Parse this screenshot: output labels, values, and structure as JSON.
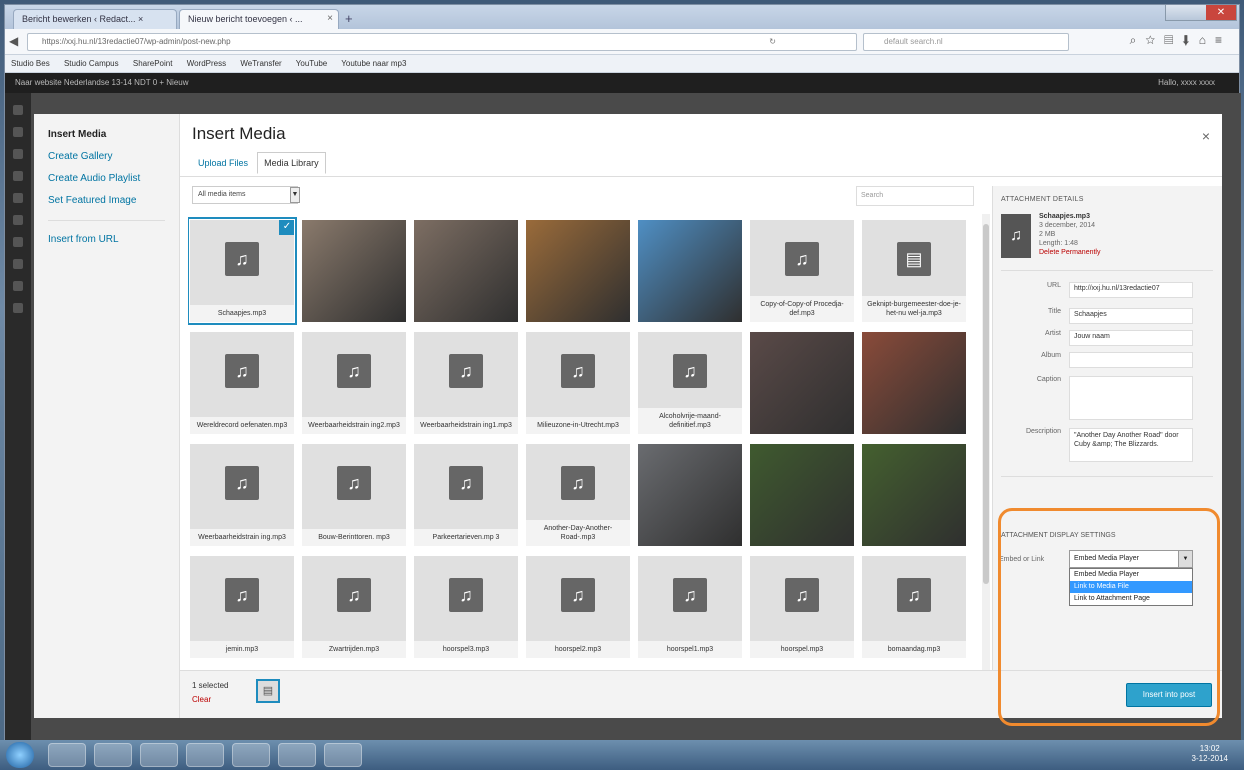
{
  "browser": {
    "tabs": [
      "Bericht bewerken ‹ Redact... ×",
      "Nieuw bericht toevoegen ‹ ..."
    ],
    "url": "https://xxj.hu.nl/13redactie07/wp-admin/post-new.php",
    "search_placeholder": "default search.nl",
    "bookmarks": [
      "Studio Bes",
      "Studio Campus",
      "SharePoint",
      "WordPress",
      "WeTransfer",
      "YouTube",
      "Youtube naar mp3"
    ]
  },
  "wpbar": {
    "left": "Naar website     Nederlandse 13-14 NDT     0     +  Nieuw",
    "right": "Hallo, xxxx xxxx"
  },
  "sidebar": {
    "title": "Insert Media",
    "items": [
      "Create Gallery",
      "Create Audio Playlist",
      "Set Featured Image",
      "Insert from URL"
    ]
  },
  "modal": {
    "title": "Insert Media",
    "close": "×",
    "tabs": [
      "Upload Files",
      "Media Library"
    ],
    "filter": "All media items",
    "search_placeholder": "Search"
  },
  "media": [
    {
      "caption": "Schaapjes.mp3",
      "type": "audio",
      "selected": true
    },
    {
      "caption": "",
      "type": "image",
      "color": "#8a7a6c"
    },
    {
      "caption": "",
      "type": "image",
      "color": "#7d6e63"
    },
    {
      "caption": "",
      "type": "image",
      "color": "#9a6b3a"
    },
    {
      "caption": "",
      "type": "image",
      "color": "#4f8fc4"
    },
    {
      "caption": "Copy-of-Copy-of Procedja-def.mp3",
      "type": "audio"
    },
    {
      "caption": "Geknipt-burgemeester-doe-je-het-nu wel-ja.mp3",
      "type": "doc"
    },
    {
      "caption": "Wereldrecord oefenaten.mp3",
      "type": "audio"
    },
    {
      "caption": "Weerbaarheidstrain ing2.mp3",
      "type": "audio"
    },
    {
      "caption": "Weerbaarheidstrain ing1.mp3",
      "type": "audio"
    },
    {
      "caption": "Milieuzone-in-Utrecht.mp3",
      "type": "audio"
    },
    {
      "caption": "Alcoholvrije-maand-definitief.mp3",
      "type": "audio"
    },
    {
      "caption": "",
      "type": "image",
      "color": "#5a4a48"
    },
    {
      "caption": "",
      "type": "image",
      "color": "#8a4b3a"
    },
    {
      "caption": "Weerbaarheidstrain ing.mp3",
      "type": "audio"
    },
    {
      "caption": "Bouw-Berinttoren. mp3",
      "type": "audio"
    },
    {
      "caption": "Parkeertarieven.mp 3",
      "type": "audio"
    },
    {
      "caption": "Another-Day-Another-Road-.mp3",
      "type": "audio"
    },
    {
      "caption": "",
      "type": "image",
      "color": "#6a6c70"
    },
    {
      "caption": "",
      "type": "image",
      "color": "#3f5a2f"
    },
    {
      "caption": "",
      "type": "image",
      "color": "#44602f"
    },
    {
      "caption": "jemin.mp3",
      "type": "audio"
    },
    {
      "caption": "Zwartrijden.mp3",
      "type": "audio"
    },
    {
      "caption": "hoorspel3.mp3",
      "type": "audio"
    },
    {
      "caption": "hoorspel2.mp3",
      "type": "audio"
    },
    {
      "caption": "hoorspel1.mp3",
      "type": "audio"
    },
    {
      "caption": "hoorspel.mp3",
      "type": "audio"
    },
    {
      "caption": "bomaandag.mp3",
      "type": "audio"
    }
  ],
  "details": {
    "heading": "ATTACHMENT DETAILS",
    "filename": "Schaapjes.mp3",
    "date": "3 december, 2014",
    "size": "2 MB",
    "length": "Length: 1:48",
    "delete": "Delete Permanently",
    "fields": [
      {
        "label": "URL",
        "value": "http://xxj.hu.nl/13redactie07"
      },
      {
        "label": "Title",
        "value": "Schaapjes"
      },
      {
        "label": "Artist",
        "value": "Jouw naam"
      },
      {
        "label": "Album",
        "value": ""
      },
      {
        "label": "Caption",
        "value": ""
      },
      {
        "label": "Description",
        "value": "\"Another Day Another Road\" door Cuby &amp; The Blizzards."
      }
    ],
    "settings_heading": "ATTACHMENT DISPLAY SETTINGS",
    "embed_label": "Embed or Link",
    "embed_value": "Embed Media Player",
    "embed_options": [
      "Embed Media Player",
      "Link to Media File",
      "Link to Attachment Page"
    ],
    "embed_highlighted": 1
  },
  "footer": {
    "selected": "1 selected",
    "clear": "Clear",
    "insert": "Insert into post"
  },
  "taskbar": {
    "time": "13:02",
    "date": "3-12-2014"
  }
}
